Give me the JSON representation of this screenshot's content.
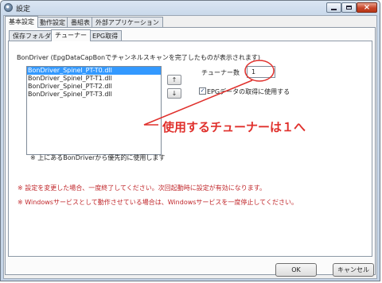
{
  "window": {
    "title": "設定",
    "icon": "gear-app-icon",
    "controls": {
      "minimize": "minimize-icon",
      "maximize": "maximize-icon",
      "close": "×"
    }
  },
  "top_tabs": [
    {
      "label": "基本設定",
      "active": true
    },
    {
      "label": "動作設定",
      "active": false
    },
    {
      "label": "番組表",
      "active": false
    },
    {
      "label": "外部アプリケーション",
      "active": false
    }
  ],
  "sub_tabs": [
    {
      "label": "保存フォルダ",
      "active": false
    },
    {
      "label": "チューナー",
      "active": true
    },
    {
      "label": "EPG取得",
      "active": false
    }
  ],
  "tuner_page": {
    "description": "BonDriver (EpgDataCapBonでチャンネルスキャンを完了したものが表示されます)",
    "bondriver_list": [
      {
        "name": "BonDriver_Spinel_PT-T0.dll",
        "selected": true
      },
      {
        "name": "BonDriver_Spinel_PT-T1.dll",
        "selected": false
      },
      {
        "name": "BonDriver_Spinel_PT-T2.dll",
        "selected": false
      },
      {
        "name": "BonDriver_Spinel_PT-T3.dll",
        "selected": false
      }
    ],
    "move_up": "↑",
    "move_down": "↓",
    "tuner_count_label": "チューナー数",
    "tuner_count_value": "1",
    "epg_checkbox_label": "EPGデータの取得に使用する",
    "epg_checkbox_checked": true,
    "priority_note": "※ 上にあるBonDriverから優先的に使用します"
  },
  "notes": {
    "restart": "※ 設定を変更した場合、一度終了してください。次回起動時に設定が有効になります。",
    "service": "※ Windowsサービスとして動作させている場合は、Windowsサービスを一度停止してください。"
  },
  "buttons": {
    "ok": "OK",
    "cancel": "キャンセル"
  },
  "annotation": {
    "text": "使用するチューナーは１へ",
    "color": "#e0302c"
  },
  "colors": {
    "selection": "#3399ff",
    "note_red": "#c0262a"
  }
}
